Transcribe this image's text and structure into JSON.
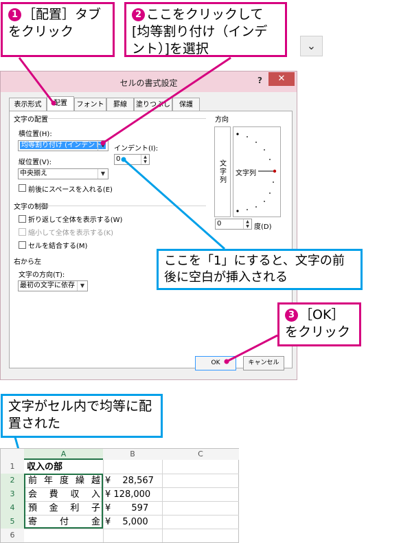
{
  "callouts": {
    "step1_text": "［配置］タブをクリック",
    "step2_text": "ここをクリックして[均等割り付け（インデント）]を選択",
    "step3_text": "［OK］をクリック",
    "note_indent": "ここを「1」にすると、文字の前後に空白が挿入される",
    "note_result": "文字がセル内で均等に配置された"
  },
  "dialog": {
    "title": "セルの書式設定",
    "help": "?",
    "close": "✕",
    "tabs": [
      "表示形式",
      "配置",
      "フォント",
      "罫線",
      "塗りつぶし",
      "保護"
    ],
    "text_alignment": {
      "section": "文字の配置",
      "horizontal_label": "横位置(H):",
      "horizontal_value": "均等割り付け (インデント)",
      "vertical_label": "縦位置(V):",
      "vertical_value": "中央揃え",
      "indent_label": "インデント(I):",
      "indent_value": "0",
      "justify_distributed": "前後にスペースを入れる(E)"
    },
    "text_control": {
      "section": "文字の制御",
      "wrap": "折り返して全体を表示する(W)",
      "shrink": "縮小して全体を表示する(K)",
      "merge": "セルを結合する(M)"
    },
    "rtl": {
      "section": "右から左",
      "direction_label": "文字の方向(T):",
      "direction_value": "最初の文字に依存"
    },
    "orientation": {
      "section": "方向",
      "vertical_text": "文字列",
      "dial_text": "文字列",
      "degrees_value": "0",
      "degrees_label": "度(D)"
    },
    "ok": "OK",
    "cancel": "キャンセル"
  },
  "chevron": "⌄",
  "sheet": {
    "columns": [
      "A",
      "B",
      "C"
    ],
    "rows": [
      "1",
      "2",
      "3",
      "4",
      "5",
      "6"
    ],
    "title": "収入の部",
    "items": [
      {
        "label": "前年度繰越",
        "amount": "¥　 28,567"
      },
      {
        "label": "会費収入",
        "amount": "¥ 128,000"
      },
      {
        "label": "預金利子",
        "amount": "¥　　 597"
      },
      {
        "label": "寄付金",
        "amount": "¥　 5,000"
      }
    ]
  },
  "colors": {
    "accent_pink": "#d6007f",
    "accent_blue": "#00a0e9",
    "titlebar": "#f3d2dc",
    "selected": "#3399ff"
  }
}
